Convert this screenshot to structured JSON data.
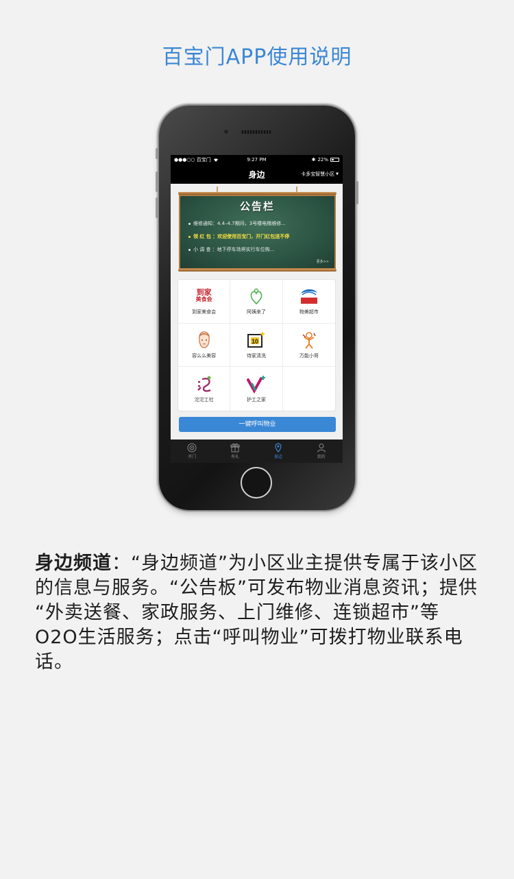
{
  "page_title": "百宝门APP使用说明",
  "status_bar": {
    "carrier": "●●●○○ 百宝门",
    "time": "9:27 PM",
    "battery": "22%"
  },
  "nav_bar": {
    "title": "身边",
    "community": "卡多宝智慧小区"
  },
  "bulletin": {
    "title": "公告栏",
    "notices": [
      "维修通知：4.4–4.7期间，3号楼电梯维修...",
      "领 红 包 ：欢迎使用百宝门，开门红包送不停",
      "小 调 查 ：地下停车场将实行车位购..."
    ],
    "more": "更多>>"
  },
  "services": [
    {
      "label": "到家美食会",
      "icon": "daojia-meishihui-icon",
      "mark": "到家\n美食会"
    },
    {
      "label": "阿姨来了",
      "icon": "ayi-laile-icon"
    },
    {
      "label": "物美超市",
      "icon": "wumei-supermarket-icon",
      "mark": "物美"
    },
    {
      "label": "容么么美容",
      "icon": "beauty-face-icon"
    },
    {
      "label": "侍家清洗",
      "icon": "cleaning-10-icon"
    },
    {
      "label": "万能小哥",
      "icon": "handyman-icon"
    },
    {
      "label": "沱沱工社",
      "icon": "tuotuo-gongshe-icon"
    },
    {
      "label": "护工之家",
      "icon": "nursing-home-icon"
    }
  ],
  "call_button": "一键呼叫物业",
  "tabs": [
    {
      "label": "开门",
      "icon": "open-door-icon",
      "active": false
    },
    {
      "label": "有礼",
      "icon": "gift-icon",
      "active": false
    },
    {
      "label": "身边",
      "icon": "location-pin-icon",
      "active": true
    },
    {
      "label": "我的",
      "icon": "person-icon",
      "active": false
    }
  ],
  "description": {
    "lead": "身边频道",
    "text": "：“身边频道”为小区业主提供专属于该小区的信息与服务。“公告板”可发布物业消息资讯；提供 “外卖送餐、家政服务、上门维修、连锁超市”等O2O生活服务；点击“呼叫物业”可拨打物业联系电话。"
  },
  "colors": {
    "accent": "#3a87d6",
    "board_green": "#2c5443",
    "highlight_yellow": "#f5e042"
  }
}
